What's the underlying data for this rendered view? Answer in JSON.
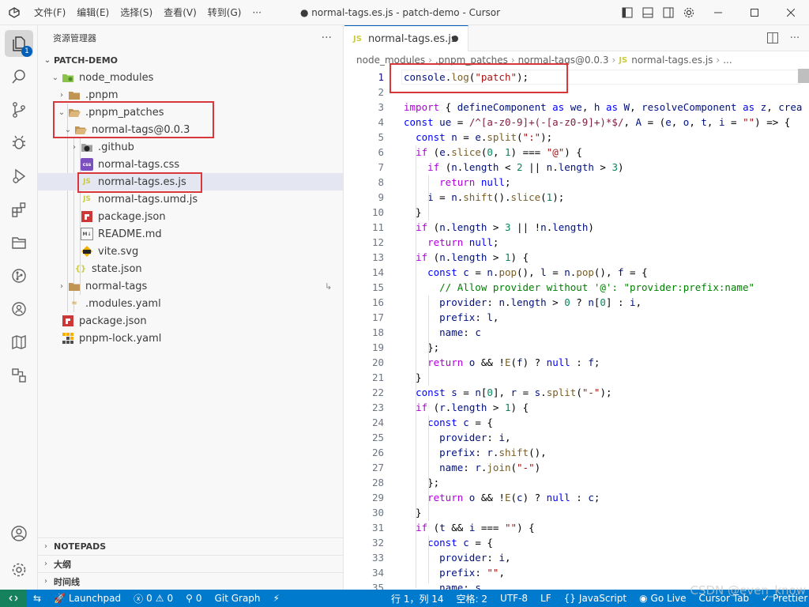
{
  "titlebar": {
    "menu": [
      "文件(F)",
      "编辑(E)",
      "选择(S)",
      "查看(V)",
      "转到(G)",
      "···"
    ],
    "title": "● normal-tags.es.js - patch-demo - Cursor"
  },
  "activitybar": {
    "explorer_badge": "1"
  },
  "sidebar": {
    "header": "资源管理器",
    "more": "···",
    "project": "PATCH-DEMO",
    "tree": [
      {
        "label": "node_modules",
        "icon": "folder-node-icon"
      },
      {
        "label": ".pnpm",
        "icon": "folder-icon"
      },
      {
        "label": ".pnpm_patches",
        "icon": "folder-open-icon"
      },
      {
        "label": "normal-tags@0.0.3",
        "icon": "folder-open-icon"
      },
      {
        "label": ".github",
        "icon": "folder-github-icon"
      },
      {
        "label": "normal-tags.css",
        "icon": "css-file-icon"
      },
      {
        "label": "normal-tags.es.js",
        "icon": "js-file-icon"
      },
      {
        "label": "normal-tags.umd.js",
        "icon": "js-file-icon"
      },
      {
        "label": "package.json",
        "icon": "npm-file-icon"
      },
      {
        "label": "README.md",
        "icon": "markdown-file-icon"
      },
      {
        "label": "vite.svg",
        "icon": "svg-file-icon"
      },
      {
        "label": "state.json",
        "icon": "json-file-icon"
      },
      {
        "label": "normal-tags",
        "icon": "folder-icon"
      },
      {
        "label": ".modules.yaml",
        "icon": "yaml-file-icon"
      },
      {
        "label": "package.json",
        "icon": "npm-file-icon"
      },
      {
        "label": "pnpm-lock.yaml",
        "icon": "pnpm-file-icon"
      }
    ],
    "panels": [
      "NOTEPADS",
      "大纲",
      "时间线"
    ]
  },
  "editor": {
    "tab_label": "normal-tags.es.js",
    "js_badge": "JS",
    "breadcrumb": [
      "node_modules",
      ".pnpm_patches",
      "normal-tags@0.0.3",
      "normal-tags.es.js",
      "..."
    ],
    "lines": [
      "console.log(\"patch\");",
      "",
      "import { defineComponent as we, h as W, resolveComponent as z, crea",
      "const ue = /^[a-z0-9]+(-[a-z0-9]+)*$/, A = (e, o, t, i = \"\") => {",
      "  const n = e.split(\":\");",
      "  if (e.slice(0, 1) === \"@\") {",
      "    if (n.length < 2 || n.length > 3)",
      "      return null;",
      "    i = n.shift().slice(1);",
      "  }",
      "  if (n.length > 3 || !n.length)",
      "    return null;",
      "  if (n.length > 1) {",
      "    const c = n.pop(), l = n.pop(), f = {",
      "      // Allow provider without '@': \"provider:prefix:name\"",
      "      provider: n.length > 0 ? n[0] : i,",
      "      prefix: l,",
      "      name: c",
      "    };",
      "    return o && !E(f) ? null : f;",
      "  }",
      "  const s = n[0], r = s.split(\"-\");",
      "  if (r.length > 1) {",
      "    const c = {",
      "      provider: i,",
      "      prefix: r.shift(),",
      "      name: r.join(\"-\")",
      "    };",
      "    return o && !E(c) ? null : c;",
      "  }",
      "  if (t && i === \"\") {",
      "    const c = {",
      "      provider: i,",
      "      prefix: \"\",",
      "      name: s"
    ]
  },
  "statusbar": {
    "launchpad": "Launchpad",
    "errors": "0",
    "warnings": "0",
    "ports": "0",
    "git_graph": "Git Graph",
    "position": "行 1，列 14",
    "spaces": "空格: 2",
    "encoding": "UTF-8",
    "eol": "LF",
    "language": "JavaScript",
    "golive": "Go Live",
    "cursor_tab": "Cursor Tab",
    "prettier": "Prettier"
  },
  "watermark": "CSDN @even_know",
  "colors": {
    "accent": "#005fb8",
    "statusbar": "#007acc",
    "highlight_box": "#d9383a"
  }
}
